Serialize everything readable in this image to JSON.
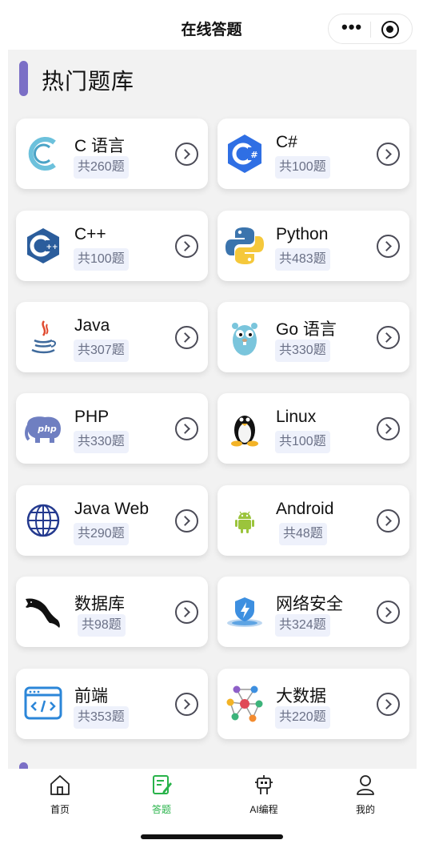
{
  "navbar": {
    "title": "在线答题"
  },
  "section": {
    "title": "热门题库"
  },
  "cards": [
    {
      "name": "C 语言",
      "count": "共260题",
      "icon": "c-language-icon"
    },
    {
      "name": "C#",
      "count": "共100题",
      "icon": "csharp-icon"
    },
    {
      "name": "C++",
      "count": "共100题",
      "icon": "cpp-icon"
    },
    {
      "name": "Python",
      "count": "共483题",
      "icon": "python-icon"
    },
    {
      "name": "Java",
      "count": "共307题",
      "icon": "java-icon"
    },
    {
      "name": "Go 语言",
      "count": "共330题",
      "icon": "go-gopher-icon"
    },
    {
      "name": "PHP",
      "count": "共330题",
      "icon": "php-elephant-icon"
    },
    {
      "name": "Linux",
      "count": "共100题",
      "icon": "linux-penguin-icon"
    },
    {
      "name": "Java Web",
      "count": "共290题",
      "icon": "globe-icon"
    },
    {
      "name": "Android",
      "count": "共48题",
      "icon": "android-icon"
    },
    {
      "name": "数据库",
      "count": "共98题",
      "icon": "mysql-dolphin-icon"
    },
    {
      "name": "网络安全",
      "count": "共324题",
      "icon": "shield-icon"
    },
    {
      "name": "前端",
      "count": "共353题",
      "icon": "code-window-icon"
    },
    {
      "name": "大数据",
      "count": "共220题",
      "icon": "network-nodes-icon"
    }
  ],
  "tabs": [
    {
      "label": "首页",
      "icon": "home-icon",
      "active": false
    },
    {
      "label": "答题",
      "icon": "edit-document-icon",
      "active": true
    },
    {
      "label": "AI编程",
      "icon": "robot-icon",
      "active": false
    },
    {
      "label": "我的",
      "icon": "user-icon",
      "active": false
    }
  ],
  "colors": {
    "accent": "#7b6fc6",
    "active_tab": "#28b34a",
    "count_badge_bg": "#eef1fb",
    "page_bg": "#f2f2f2"
  }
}
